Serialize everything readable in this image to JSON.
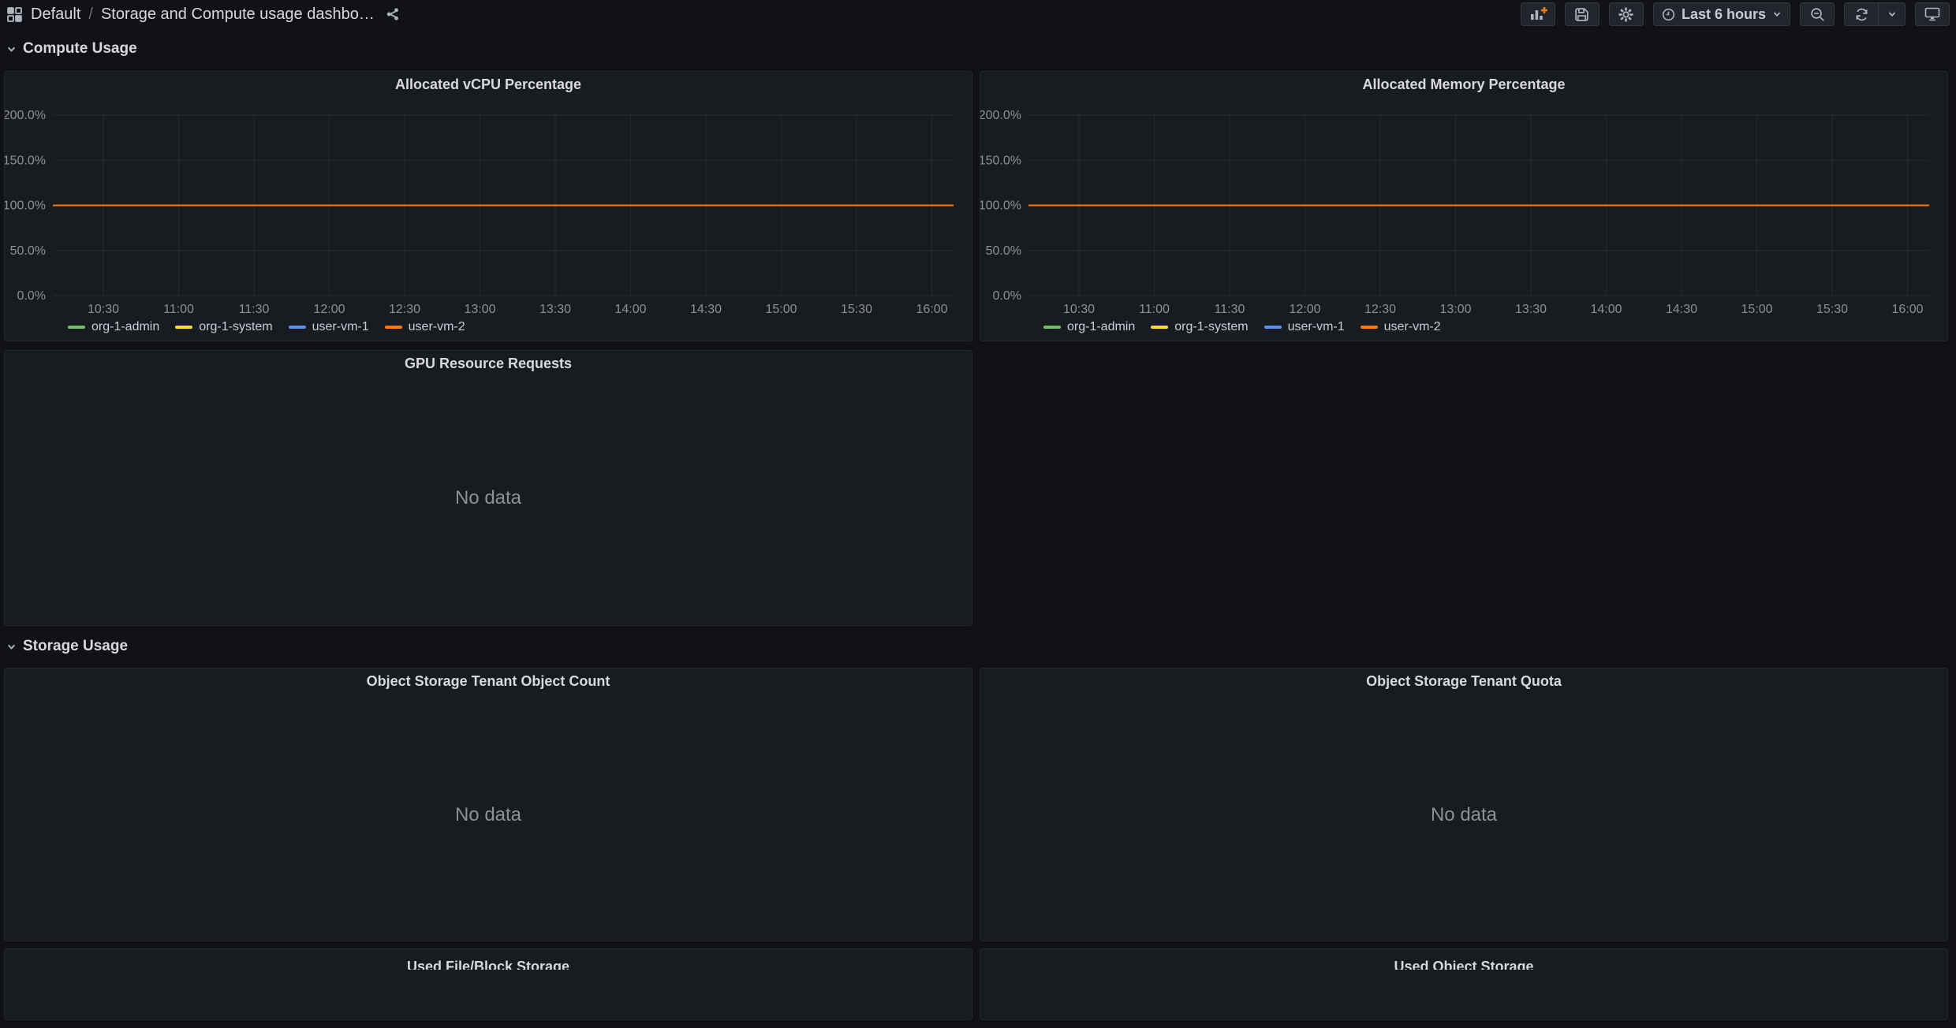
{
  "topbar": {
    "breadcrumb": {
      "folder": "Default",
      "separator": "/",
      "dashboard": "Storage and Compute usage dashbo…"
    },
    "icons": [
      "apps-icon",
      "share-icon",
      "add-panel-icon",
      "save-icon",
      "settings-gear-icon",
      "clock-icon",
      "caret-down-icon",
      "zoom-out-icon",
      "refresh-icon",
      "monitor-icon"
    ],
    "time_range": {
      "label": "Last 6 hours"
    }
  },
  "sections": {
    "compute": {
      "title": "Compute Usage"
    },
    "storage": {
      "title": "Storage Usage"
    }
  },
  "panels": {
    "vcpu": {
      "title": "Allocated vCPU Percentage"
    },
    "memory": {
      "title": "Allocated Memory Percentage"
    },
    "gpu": {
      "title": "GPU Resource Requests",
      "no_data": "No data"
    },
    "object_count": {
      "title": "Object Storage Tenant Object Count",
      "no_data": "No data"
    },
    "quota": {
      "title": "Object Storage Tenant Quota",
      "no_data": "No data"
    },
    "file_block": {
      "title": "Used File/Block Storage"
    },
    "object_used": {
      "title": "Used Object Storage"
    }
  },
  "colors": {
    "page_bg": "#111217",
    "panel_bg": "#181b1f",
    "grid_line": "rgba(204,204,220,0.08)",
    "axis_text": "rgba(204,204,220,0.65)",
    "series_green": "#73BF69",
    "series_yellow": "#FADE2A",
    "series_blue": "#5794F2",
    "series_orange": "#FF780A"
  },
  "chart_data": [
    {
      "id": "vcpu",
      "type": "line",
      "title": "Allocated vCPU Percentage",
      "ylabel": "",
      "xlabel": "",
      "ylim": [
        0,
        200
      ],
      "y_tick_values": [
        0,
        50,
        100,
        150,
        200
      ],
      "y_tick_labels": [
        "0.0%",
        "50.0%",
        "100.0%",
        "150.0%",
        "200.0%"
      ],
      "x_tick_labels": [
        "10:30",
        "11:00",
        "11:30",
        "12:00",
        "12:30",
        "13:00",
        "13:30",
        "14:00",
        "14:30",
        "15:00",
        "15:30",
        "16:00"
      ],
      "grid": true,
      "legend_position": "bottom-left",
      "series": [
        {
          "name": "org-1-admin",
          "color": "#73BF69",
          "constant_value": 100
        },
        {
          "name": "org-1-system",
          "color": "#FADE2A",
          "constant_value": 100
        },
        {
          "name": "user-vm-1",
          "color": "#5794F2",
          "constant_value": 100
        },
        {
          "name": "user-vm-2",
          "color": "#FF780A",
          "constant_value": 100
        }
      ]
    },
    {
      "id": "memory",
      "type": "line",
      "title": "Allocated Memory Percentage",
      "ylabel": "",
      "xlabel": "",
      "ylim": [
        0,
        200
      ],
      "y_tick_values": [
        0,
        50,
        100,
        150,
        200
      ],
      "y_tick_labels": [
        "0.0%",
        "50.0%",
        "100.0%",
        "150.0%",
        "200.0%"
      ],
      "x_tick_labels": [
        "10:30",
        "11:00",
        "11:30",
        "12:00",
        "12:30",
        "13:00",
        "13:30",
        "14:00",
        "14:30",
        "15:00",
        "15:30",
        "16:00"
      ],
      "grid": true,
      "legend_position": "bottom-left",
      "series": [
        {
          "name": "org-1-admin",
          "color": "#73BF69",
          "constant_value": 100
        },
        {
          "name": "org-1-system",
          "color": "#FADE2A",
          "constant_value": 100
        },
        {
          "name": "user-vm-1",
          "color": "#5794F2",
          "constant_value": 100
        },
        {
          "name": "user-vm-2",
          "color": "#FF780A",
          "constant_value": 100
        }
      ]
    }
  ]
}
